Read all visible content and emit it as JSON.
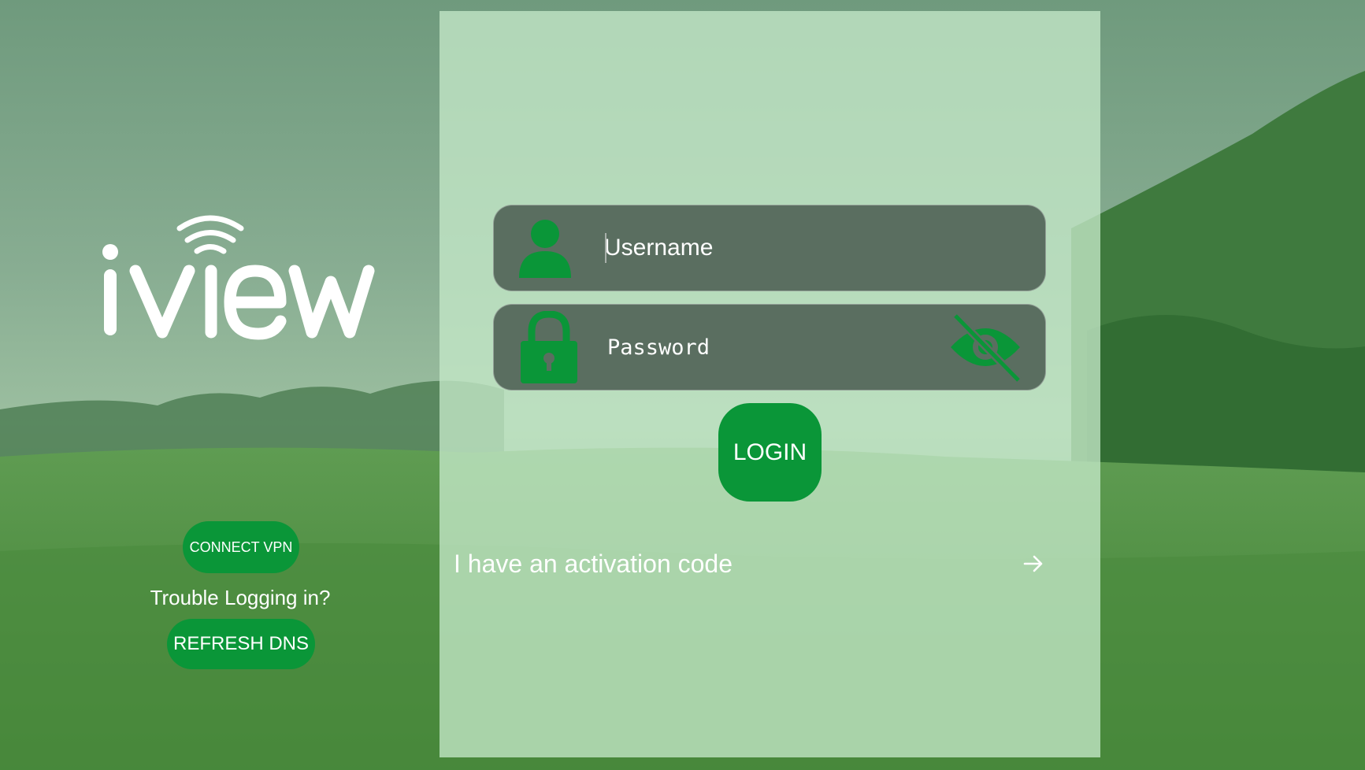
{
  "brand": {
    "logo_text": "iview"
  },
  "left_actions": {
    "connect_vpn_label": "CONNECT VPN",
    "trouble_text": "Trouble Logging in?",
    "refresh_dns_label": "REFRESH DNS"
  },
  "login_form": {
    "username_placeholder": "Username",
    "username_value": "",
    "password_placeholder": "Password",
    "password_value": "",
    "password_visibility": "hidden",
    "login_label": "LOGIN",
    "activation_label": "I have an activation code"
  },
  "icons": {
    "username": "person-icon",
    "password": "lock-icon",
    "toggle": "eye-off-icon",
    "activation": "arrow-right-icon"
  },
  "colors": {
    "accent_green": "#0a9638",
    "field_bg": "#5a6e60",
    "panel_overlay": "#c4e8c8",
    "text": "#ffffff"
  }
}
